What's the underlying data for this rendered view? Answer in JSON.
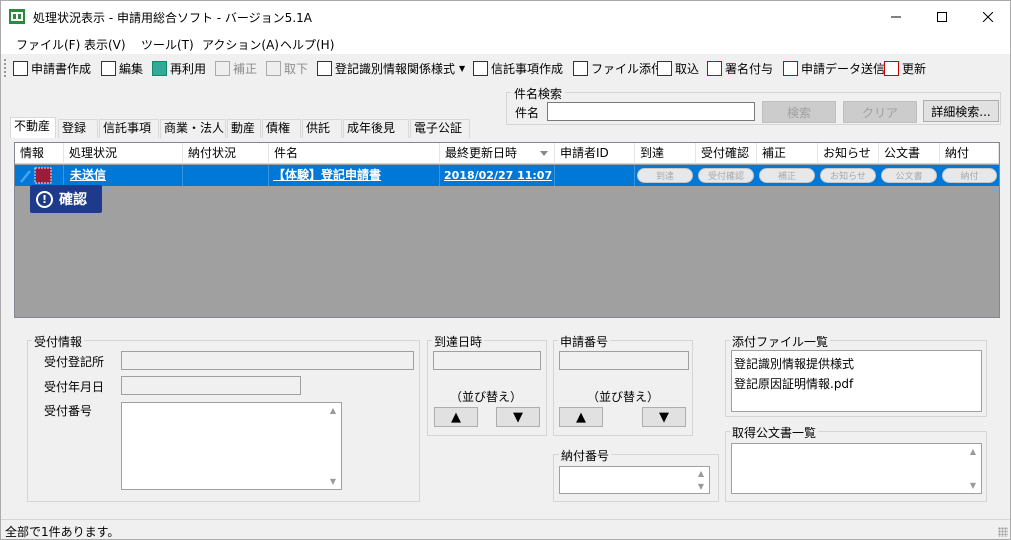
{
  "window": {
    "title": "処理状況表示 - 申請用総合ソフト - バージョン5.1A"
  },
  "menu": [
    "ファイル(F)",
    "表示(V)",
    "ツール(T)",
    "アクション(A)",
    "ヘルプ(H)"
  ],
  "toolbar": {
    "create_application": "申請書作成",
    "edit": "編集",
    "reuse": "再利用",
    "correction": "補正",
    "withdraw": "取下",
    "registration_info_form": "登記識別情報関係様式",
    "trust_matters": "信託事項作成",
    "attach_file": "ファイル添付",
    "import": "取込",
    "sign": "署名付与",
    "send_data": "申請データ送信",
    "refresh": "更新"
  },
  "search": {
    "group_label": "件名検索",
    "field_label": "件名",
    "value": "",
    "search_button": "検索",
    "clear_button": "クリア",
    "detail_button": "詳細検索..."
  },
  "tabs": [
    "不動産",
    "登録",
    "信託事項",
    "商業・法人",
    "動産",
    "債権",
    "供託",
    "成年後見",
    "電子公証"
  ],
  "grid": {
    "columns": [
      "情報",
      "処理状況",
      "納付状況",
      "件名",
      "最終更新日時",
      "申請者ID",
      "到達",
      "受付確認",
      "補正",
      "お知らせ",
      "公文書",
      "納付"
    ],
    "rows": [
      {
        "status": "未送信",
        "payment": "",
        "subject": "【体験】登記申請書",
        "updated": "2018/02/27 11:07",
        "applicant_id": "",
        "arrival": "到達",
        "receipt": "受付確認",
        "correction": "補正",
        "notice": "お知らせ",
        "official_doc": "公文書",
        "payment_btn": "納付"
      }
    ],
    "badge": "確認"
  },
  "receipt_info": {
    "legend": "受付情報",
    "office_label": "受付登記所",
    "date_label": "受付年月日",
    "number_label": "受付番号"
  },
  "arrival_panel": {
    "legend": "到達日時",
    "sort_label": "（並び替え）",
    "up": "▲",
    "down": "▼"
  },
  "application_number_panel": {
    "legend": "申請番号",
    "sort_label": "（並び替え）",
    "up": "▲",
    "down": "▼"
  },
  "payment_number_panel": {
    "legend": "納付番号"
  },
  "attachments": {
    "legend": "添付ファイル一覧",
    "items": [
      "登記識別情報提供様式",
      "登記原因証明情報.pdf"
    ]
  },
  "official_docs": {
    "legend": "取得公文書一覧"
  },
  "status_bar": {
    "text": "全部で1件あります。"
  }
}
